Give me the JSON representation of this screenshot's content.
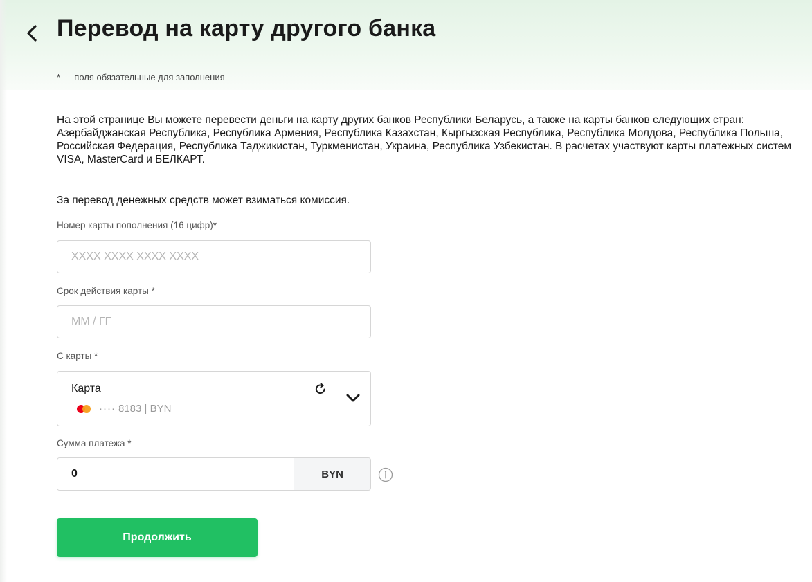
{
  "header": {
    "title": "Перевод на карту другого банка",
    "required_note": "* — поля обязательные для заполнения"
  },
  "info": {
    "description": "На этой странице Вы можете перевести деньги на карту других банков Республики Беларусь, а также на карты банков следующих стран: Азербайджанская Республика, Республика Армения, Республика Казахстан, Кыргызская Республика, Республика Молдова, Республика Польша, Российская Федерация, Республика Таджикистан, Туркменистан, Украина, Республика Узбекистан. В расчетах участвуют карты платежных систем VISA, MasterCard и БЕЛКАРТ.",
    "commission": "За перевод денежных средств может взиматься комиссия."
  },
  "form": {
    "card_number": {
      "label": "Номер карты пополнения (16 цифр)*",
      "placeholder": "XXXX XXXX XXXX XXXX",
      "value": ""
    },
    "expiry": {
      "label": "Срок действия карты *",
      "placeholder": "ММ / ГГ",
      "value": ""
    },
    "from_card": {
      "label": "С карты *",
      "card_name": "Карта",
      "card_dots": "····",
      "card_suffix": "8183 | BYN",
      "icon_refresh": "refresh-icon",
      "icon_dropdown": "chevron-down-icon",
      "brand_icon": "mastercard-icon"
    },
    "amount": {
      "label": "Сумма платежа *",
      "value": "0",
      "currency": "BYN",
      "icon_info": "info-icon"
    },
    "submit_label": "Продолжить"
  },
  "colors": {
    "accent": "#21c063",
    "header_tint": "#e4f3e6",
    "border": "#d6d6d6"
  }
}
